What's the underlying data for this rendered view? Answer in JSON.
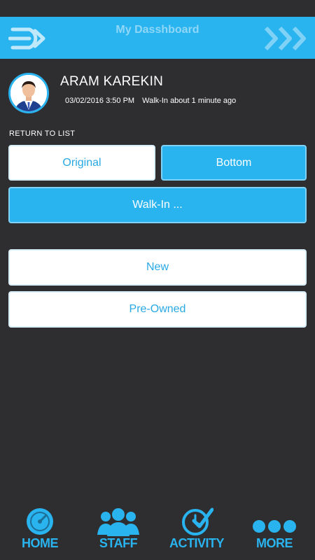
{
  "header": {
    "title": "My Dasshboard"
  },
  "profile": {
    "name": "ARAM KAREKIN",
    "datetime": "03/02/2016 3:50 PM",
    "status": "Walk-In about 1 minute ago"
  },
  "return_link": "RETURN TO LIST",
  "buttons": {
    "original": "Original",
    "bottom": "Bottom",
    "walkin": "Walk-In ...",
    "new": "New",
    "preowned": "Pre-Owned"
  },
  "tabs": [
    {
      "label": "HOME",
      "icon": "gauge-icon"
    },
    {
      "label": "STAFF",
      "icon": "people-icon"
    },
    {
      "label": "ACTIVITY",
      "icon": "clock-check-icon"
    },
    {
      "label": "MORE",
      "icon": "more-dots-icon"
    }
  ],
  "colors": {
    "accent": "#29b3ef",
    "background": "#2e2e30",
    "button_white": "#ffffff"
  }
}
